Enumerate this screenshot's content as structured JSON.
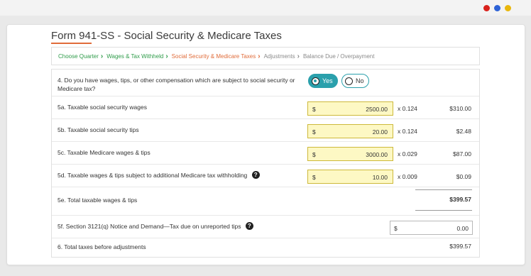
{
  "window": {
    "controls": [
      {
        "name": "close",
        "color": "#d9211c"
      },
      {
        "name": "minimize",
        "color": "#2d62d6"
      },
      {
        "name": "maximize",
        "color": "#e9b70c"
      }
    ]
  },
  "form": {
    "title": "Form 941-SS - Social Security & Medicare Taxes",
    "accent_color": "#e06c3a"
  },
  "breadcrumb": {
    "steps": [
      {
        "label": "Choose Quarter",
        "state": "done",
        "color": "#2f9c4a"
      },
      {
        "label": "Wages & Tax Withheld",
        "state": "done",
        "color": "#2f9c4a"
      },
      {
        "label": "Social Security & Medicare Taxes",
        "state": "current",
        "color": "#e06c3a"
      },
      {
        "label": "Adjustments",
        "state": "todo",
        "color": "#8a8a8a"
      },
      {
        "label": "Balance Due / Overpayment",
        "state": "todo",
        "color": "#8a8a8a"
      }
    ],
    "separator_icon": "chevron-right-icon"
  },
  "q4": {
    "question": "4. Do you have wages, tips, or other compensation which are subject to social security or Medicare tax?",
    "yes_label": "Yes",
    "no_label": "No",
    "selected": "Yes",
    "toggle_color": "#2aa0ac"
  },
  "lines": {
    "l5a": {
      "label": "5a. Taxable social security wages",
      "currency": "$",
      "amount": "2500.00",
      "multiplier": "x 0.124",
      "result": "$310.00"
    },
    "l5b": {
      "label": "5b. Taxable social security tips",
      "currency": "$",
      "amount": "20.00",
      "multiplier": "x 0.124",
      "result": "$2.48"
    },
    "l5c": {
      "label": "5c. Taxable Medicare wages & tips",
      "currency": "$",
      "amount": "3000.00",
      "multiplier": "x 0.029",
      "result": "$87.00"
    },
    "l5d": {
      "label": "5d. Taxable wages & tips subject to additional Medicare tax withholding",
      "currency": "$",
      "amount": "10.00",
      "multiplier": "x 0.009",
      "result": "$0.09",
      "help_icon": "help-icon"
    },
    "l5e": {
      "label": "5e. Total taxable wages & tips",
      "total": "$399.57"
    },
    "l5f": {
      "label": "5f. Section 3121(q) Notice and Demand—Tax due on unreported tips",
      "currency": "$",
      "amount": "0.00",
      "help_icon": "help-icon"
    },
    "l6": {
      "label": "6. Total taxes before adjustments",
      "total": "$399.57"
    }
  },
  "input_highlight_color": "#fdf8c4"
}
